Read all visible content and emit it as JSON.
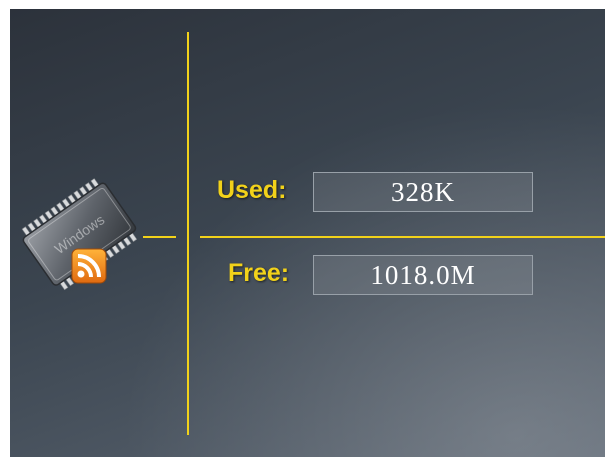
{
  "memory": {
    "used_label": "Used:",
    "used_value": "328K",
    "free_label": "Free:",
    "free_value": "1018.0M"
  },
  "icon": {
    "name": "memory-chip-rss-icon",
    "chip_text": "Windows"
  },
  "colors": {
    "accent": "#f2d21a",
    "background": "#3b4550",
    "value_text": "#ffffff",
    "badge": "#f0a020"
  }
}
